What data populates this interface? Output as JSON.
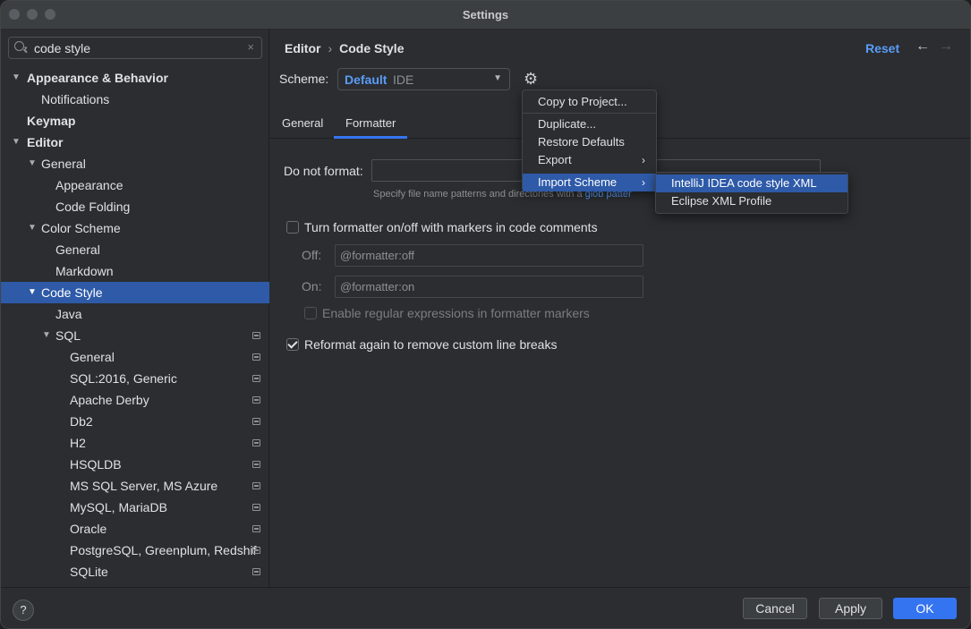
{
  "window": {
    "title": "Settings"
  },
  "sidebar": {
    "search": {
      "value": "code style",
      "clear_icon": "×"
    },
    "tree": [
      {
        "label": "Appearance & Behavior",
        "bold": true,
        "expanded": true
      },
      {
        "label": "Notifications"
      },
      {
        "label": "Keymap",
        "bold": true
      },
      {
        "label": "Editor",
        "bold": true,
        "expanded": true
      },
      {
        "label": "General",
        "expanded": true
      },
      {
        "label": "Appearance"
      },
      {
        "label": "Code Folding"
      },
      {
        "label": "Color Scheme",
        "expanded": true
      },
      {
        "label": "General"
      },
      {
        "label": "Markdown"
      },
      {
        "label": "Code Style",
        "selected": true,
        "expanded": true
      },
      {
        "label": "Java"
      },
      {
        "label": "SQL",
        "expanded": true,
        "project_icon": true
      },
      {
        "label": "General",
        "project_icon": true
      },
      {
        "label": "SQL:2016, Generic",
        "project_icon": true
      },
      {
        "label": "Apache Derby",
        "project_icon": true
      },
      {
        "label": "Db2",
        "project_icon": true
      },
      {
        "label": "H2",
        "project_icon": true
      },
      {
        "label": "HSQLDB",
        "project_icon": true
      },
      {
        "label": "MS SQL Server, MS Azure",
        "project_icon": true
      },
      {
        "label": "MySQL, MariaDB",
        "project_icon": true
      },
      {
        "label": "Oracle",
        "project_icon": true
      },
      {
        "label": "PostgreSQL, Greenplum, Redshif",
        "project_icon": true
      },
      {
        "label": "SQLite",
        "project_icon": true
      }
    ]
  },
  "header": {
    "breadcrumb": [
      "Editor",
      "Code Style"
    ],
    "breadcrumb_sep": "›",
    "reset_label": "Reset",
    "back_icon": "←",
    "forward_icon": "→"
  },
  "scheme": {
    "label": "Scheme:",
    "name": "Default",
    "kind": "IDE",
    "dropdown_icon": "▼",
    "gear_icon": "⚙"
  },
  "tabs": [
    {
      "label": "General"
    },
    {
      "label": "Formatter",
      "active": true
    }
  ],
  "formatter": {
    "do_not_format_label": "Do not format:",
    "do_not_format_value": "",
    "hint_prefix": "Specify file name patterns and directories with a",
    "hint_link": "glob patter",
    "toggle_markers_label": "Turn formatter on/off with markers in code comments",
    "toggle_markers_checked": false,
    "off_label": "Off:",
    "off_placeholder": "@formatter:off",
    "on_label": "On:",
    "on_placeholder": "@formatter:on",
    "regex_label": "Enable regular expressions in formatter markers",
    "regex_checked": false,
    "reformat_label": "Reformat again to remove custom line breaks",
    "reformat_checked": true
  },
  "gear_menu": {
    "items": [
      {
        "label": "Copy to Project..."
      },
      {
        "label": "Duplicate..."
      },
      {
        "label": "Restore Defaults"
      },
      {
        "label": "Export",
        "submenu_arrow": "›"
      },
      {
        "label": "Import Scheme",
        "submenu_arrow": "›",
        "highlighted": true
      }
    ]
  },
  "import_submenu": {
    "items": [
      {
        "label": "IntelliJ IDEA code style XML",
        "highlighted": true
      },
      {
        "label": "Eclipse XML Profile"
      }
    ]
  },
  "footer": {
    "help_label": "?",
    "cancel_label": "Cancel",
    "apply_label": "Apply",
    "ok_label": "OK"
  },
  "colors": {
    "accent": "#3574f0",
    "selection": "#2e5aa8",
    "link": "#5a9cf8",
    "background": "#2b2d30"
  }
}
